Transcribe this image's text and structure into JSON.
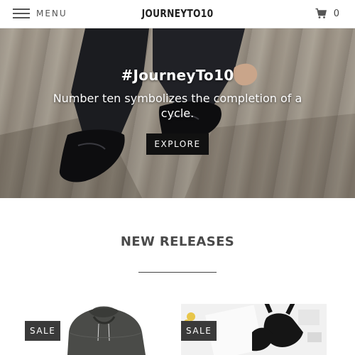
{
  "header": {
    "menu_label": "MENU",
    "logo_text": "JOURNEYTO10",
    "cart_count": "0"
  },
  "hero": {
    "title": "#JourneyTo10",
    "subtitle": "Number ten symbolizes the completion of a cycle.",
    "button_label": "EXPLORE"
  },
  "new_releases": {
    "title": "NEW RELEASES",
    "products": [
      {
        "badge": "SALE",
        "image": "grey hooded sweater"
      },
      {
        "badge": "SALE",
        "image": "black sports bra with white letter straps"
      }
    ]
  },
  "colors": {
    "header_bg": "#ffffff",
    "button_bg": "#111111",
    "badge_bg": "#3a3a3a",
    "title_text": "#4a4a4a"
  }
}
